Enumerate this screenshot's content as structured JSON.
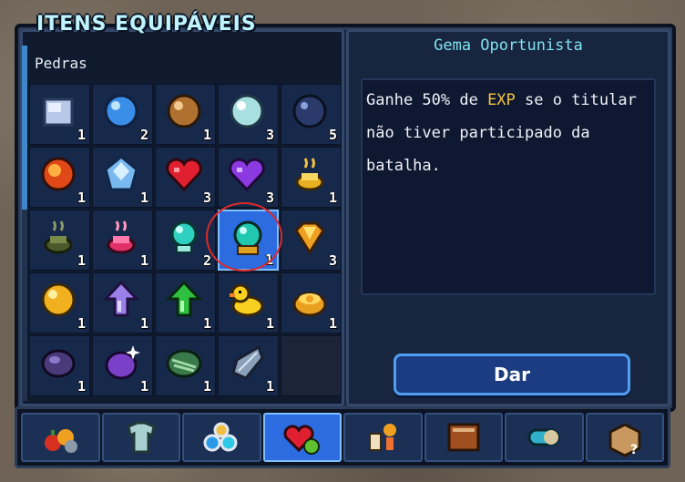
{
  "title": "ITENS EQUIPÁVEIS",
  "category": "Pedras",
  "selected_item": {
    "name": "Gema Oportunista",
    "description_parts": [
      "Ganhe 50% de ",
      "EXP",
      " se o titular não tiver participado da batalha."
    ]
  },
  "give_button": "Dar",
  "items": [
    {
      "icon": "ice-cube-stone-icon",
      "qty": "1"
    },
    {
      "icon": "blue-orb-icon",
      "qty": "2"
    },
    {
      "icon": "brown-orb-icon",
      "qty": "1"
    },
    {
      "icon": "pale-orb-icon",
      "qty": "3"
    },
    {
      "icon": "dark-orb-icon",
      "qty": "5"
    },
    {
      "icon": "fire-orb-icon",
      "qty": "1"
    },
    {
      "icon": "ice-crystal-icon",
      "qty": "1"
    },
    {
      "icon": "red-heart-gem-icon",
      "qty": "3"
    },
    {
      "icon": "purple-heart-gem-icon",
      "qty": "3"
    },
    {
      "icon": "gold-incense-icon",
      "qty": "1"
    },
    {
      "icon": "green-incense-icon",
      "qty": "1"
    },
    {
      "icon": "pink-incense-icon",
      "qty": "1"
    },
    {
      "icon": "teal-gem-icon",
      "qty": "2"
    },
    {
      "icon": "opportunist-gem-icon",
      "qty": "1"
    },
    {
      "icon": "gold-diamond-icon",
      "qty": "3"
    },
    {
      "icon": "gold-orb-icon",
      "qty": "1"
    },
    {
      "icon": "purple-arrow-icon",
      "qty": "1"
    },
    {
      "icon": "green-arrow-icon",
      "qty": "1"
    },
    {
      "icon": "rubber-duck-icon",
      "qty": "1"
    },
    {
      "icon": "gold-coin-bowl-icon",
      "qty": "1"
    },
    {
      "icon": "purple-stone-icon",
      "qty": "1"
    },
    {
      "icon": "sparkle-purple-stone-icon",
      "qty": "1"
    },
    {
      "icon": "green-striped-stone-icon",
      "qty": "1"
    },
    {
      "icon": "silver-leaf-stone-icon",
      "qty": "1"
    },
    {
      "icon": "",
      "qty": ""
    }
  ],
  "selected_index": 13,
  "tabs": [
    {
      "icon": "fruit-tab-icon"
    },
    {
      "icon": "armor-tab-icon"
    },
    {
      "icon": "orbs-tab-icon"
    },
    {
      "icon": "hearts-tab-icon"
    },
    {
      "icon": "potions-tab-icon"
    },
    {
      "icon": "book-tab-icon"
    },
    {
      "icon": "capsule-tab-icon"
    },
    {
      "icon": "mystery-box-tab-icon"
    }
  ],
  "active_tab": 3,
  "colors": {
    "accent": "#2c6ce0",
    "title": "#bff4ff",
    "highlight": "#f5c640",
    "gem_name": "#7ee2f0"
  }
}
